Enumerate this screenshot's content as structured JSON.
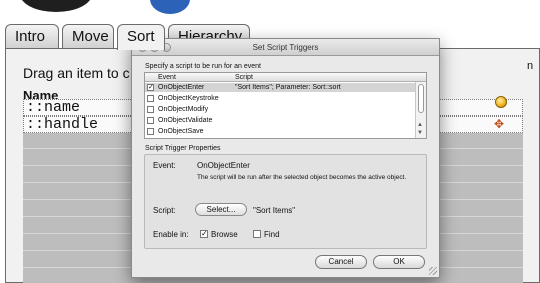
{
  "tabs": [
    {
      "label": "Intro"
    },
    {
      "label": "Move"
    },
    {
      "label": "Sort"
    },
    {
      "label": "Hierarchy"
    }
  ],
  "panel": {
    "instruction": "Drag an item to c",
    "heading": "Name",
    "right_note": "n",
    "field_rows": [
      {
        "text": "::name"
      },
      {
        "text": "::handle"
      }
    ]
  },
  "dialog": {
    "title": "Set Script Triggers",
    "prompt": "Specify a script to be run for an event",
    "columns": {
      "event": "Event",
      "script": "Script"
    },
    "triggers": [
      {
        "event": "OnObjectEnter",
        "script": "\"Sort Items\"; Parameter: Sort::sort",
        "checked": true
      },
      {
        "event": "OnObjectKeystroke",
        "script": "",
        "checked": false
      },
      {
        "event": "OnObjectModify",
        "script": "",
        "checked": false
      },
      {
        "event": "OnObjectValidate",
        "script": "",
        "checked": false
      },
      {
        "event": "OnObjectSave",
        "script": "",
        "checked": false
      }
    ],
    "properties_legend": "Script Trigger Properties",
    "event_label": "Event:",
    "event_name": "OnObjectEnter",
    "event_description": "The script will be run after the selected object becomes the active object.",
    "script_label": "Script:",
    "select_button": "Select...",
    "script_name": "\"Sort Items\"",
    "enable_label": "Enable in:",
    "browse_label": "Browse",
    "browse_checked": true,
    "find_label": "Find",
    "find_checked": false,
    "cancel_button": "Cancel",
    "ok_button": "OK"
  },
  "colors": {
    "selected_row": "#d4d4d4",
    "list_background": "#bdbdbd",
    "logo_blue": "#2c63b8"
  }
}
